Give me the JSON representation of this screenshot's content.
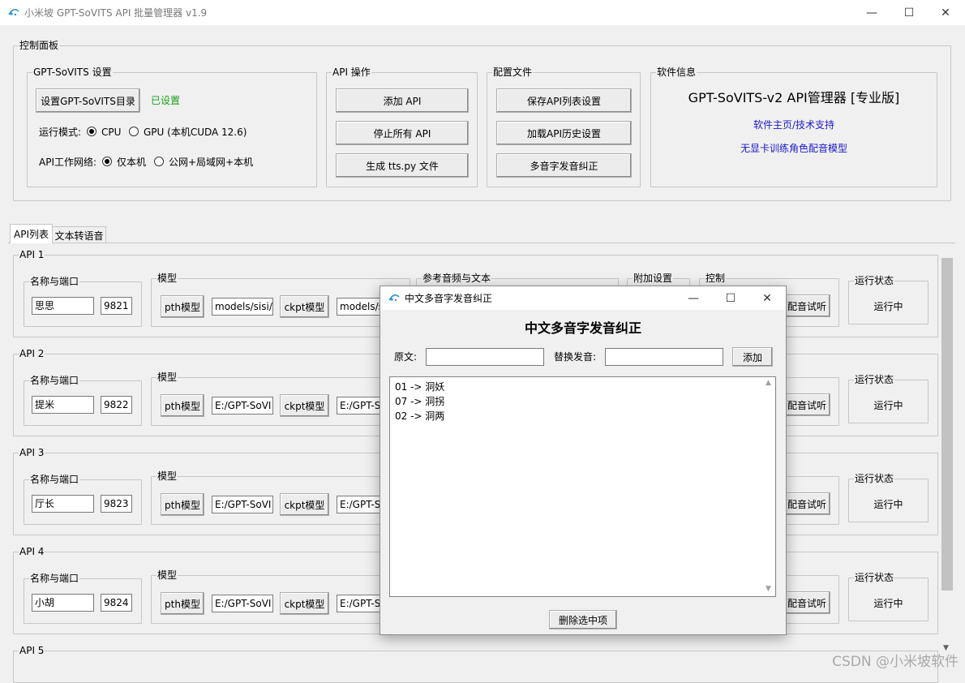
{
  "window": {
    "title": "小米坡 GPT-SoVITS API 批量管理器 v1.9",
    "controls": {
      "minimize": "—",
      "maximize": "☐",
      "close": "✕"
    }
  },
  "control_panel": {
    "title": "控制面板",
    "gpt_settings": {
      "title": "GPT-SoVITS 设置",
      "set_dir_button": "设置GPT-SoVITS目录",
      "set_status": "已设置",
      "run_mode_label": "运行模式:",
      "cpu_label": "CPU",
      "gpu_label": "GPU (本机CUDA 12.6)",
      "network_label": "API工作网络:",
      "local_label": "仅本机",
      "public_label": "公网+局域网+本机",
      "run_mode": "CPU",
      "network": "仅本机"
    },
    "api_ops": {
      "title": "API 操作",
      "add_api": "添加 API",
      "stop_all": "停止所有 API",
      "gen_tts": "生成 tts.py 文件"
    },
    "config": {
      "title": "配置文件",
      "save": "保存API列表设置",
      "load": "加载API历史设置",
      "polyphone": "多音字发音纠正"
    },
    "software_info": {
      "title": "软件信息",
      "name": "GPT-SoVITS-v2 API管理器 [专业版]",
      "homepage": "软件主页/技术支持",
      "no_gpu_model": "无显卡训练角色配音模型"
    }
  },
  "tabs": [
    "API列表",
    "文本转语音"
  ],
  "api_list": {
    "name_port_label": "名称与端口",
    "model_label": "模型",
    "ref_label": "参考音频与文本",
    "extra_label": "附加设置",
    "control_label": "控制",
    "pth_button": "pth模型",
    "ckpt_button": "ckpt模型",
    "test_button": "配音试听",
    "status_label": "运行状态",
    "items": [
      {
        "title": "API 1",
        "name": "思思",
        "port": "9821",
        "pth": "models/sisi/",
        "ckpt": "models/s",
        "status": "运行中"
      },
      {
        "title": "API 2",
        "name": "提米",
        "port": "9822",
        "pth": "E:/GPT-SoVI",
        "ckpt": "E:/GPT-S",
        "status": "运行中"
      },
      {
        "title": "API 3",
        "name": "厅长",
        "port": "9823",
        "pth": "E:/GPT-SoVI",
        "ckpt": "E:/GPT-S",
        "status": "运行中"
      },
      {
        "title": "API 4",
        "name": "小胡",
        "port": "9824",
        "pth": "E:/GPT-SoVI",
        "ckpt": "E:/GPT-S",
        "status": "运行中"
      },
      {
        "title": "API 5"
      }
    ]
  },
  "dialog": {
    "window_title": "中文多音字发音纠正",
    "heading": "中文多音字发音纠正",
    "original_label": "原文:",
    "replace_label": "替换发音:",
    "original_value": "",
    "replace_value": "",
    "add_button": "添加",
    "entries": [
      "01 -> 洞妖",
      "07 -> 洞拐",
      "02 -> 洞两"
    ],
    "delete_button": "删除选中项"
  },
  "watermark": "CSDN @小米坡软件"
}
